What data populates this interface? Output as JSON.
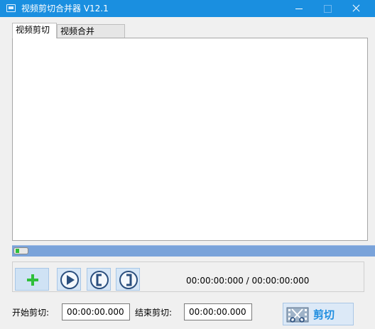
{
  "window": {
    "title": "视频剪切合并器 V12.1"
  },
  "tabs": [
    {
      "label": "视频剪切",
      "active": true
    },
    {
      "label": "视频合并",
      "active": false
    }
  ],
  "playback": {
    "position_fraction": 0.0,
    "time_display": "00:00:00:000 / 00:00:00:000"
  },
  "controls": {
    "add_icon": "plus-icon",
    "play_icon": "play-icon",
    "mark_in_icon": "left-bracket-icon",
    "mark_out_icon": "right-bracket-icon"
  },
  "cut": {
    "start_label": "开始剪切:",
    "start_value": "00:00:00.000",
    "end_label": "结束剪切:",
    "end_value": "00:00:00.000",
    "button_label": "剪切",
    "button_icon": "film-scissors-icon"
  },
  "colors": {
    "titlebar": "#1a8fe0",
    "progress_track": "#7aa3da",
    "accent_green": "#2fbf3a",
    "cut_text": "#1f8ee0"
  }
}
